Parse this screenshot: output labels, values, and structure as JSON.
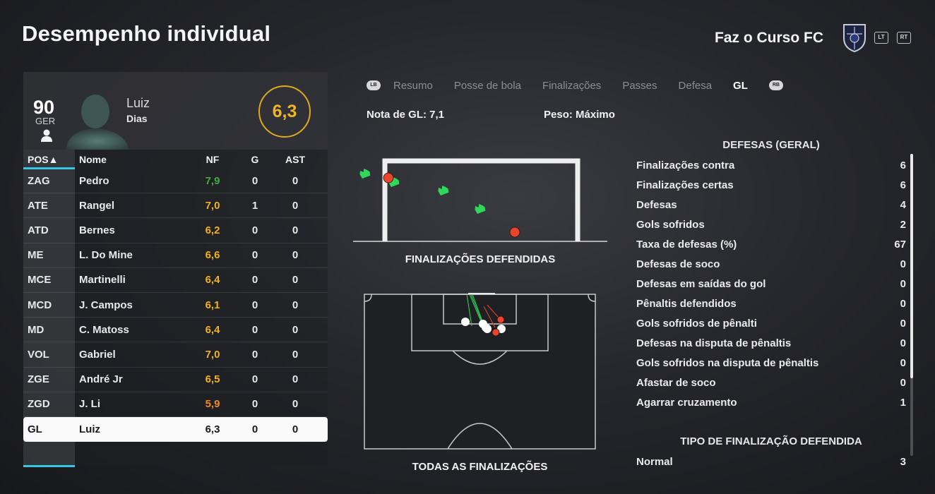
{
  "header": {
    "title": "Desempenho individual",
    "club_name": "Faz o Curso FC",
    "lt_label": "LT",
    "rt_label": "RT"
  },
  "player": {
    "overall": "90",
    "position": "GER",
    "first_name": "Luiz",
    "last_name": "Dias",
    "match_rating": "6,3"
  },
  "table": {
    "headers": {
      "pos": "POS▲",
      "name": "Nome",
      "nf": "NF",
      "g": "G",
      "ast": "AST"
    },
    "rows": [
      {
        "pos": "ZAG",
        "name": "Pedro",
        "nf": "7,9",
        "g": "0",
        "ast": "0",
        "nf_color": "#3fae3f"
      },
      {
        "pos": "ATE",
        "name": "Rangel",
        "nf": "7,0",
        "g": "1",
        "ast": "0",
        "nf_color": "#f0b21f"
      },
      {
        "pos": "ATD",
        "name": "Bernes",
        "nf": "6,2",
        "g": "0",
        "ast": "0",
        "nf_color": "#f0b21f"
      },
      {
        "pos": "ME",
        "name": "L. Do Mine",
        "nf": "6,6",
        "g": "0",
        "ast": "0",
        "nf_color": "#f0b21f"
      },
      {
        "pos": "MCE",
        "name": "Martinelli",
        "nf": "6,4",
        "g": "0",
        "ast": "0",
        "nf_color": "#f0b21f"
      },
      {
        "pos": "MCD",
        "name": "J. Campos",
        "nf": "6,1",
        "g": "0",
        "ast": "0",
        "nf_color": "#f0b21f"
      },
      {
        "pos": "MD",
        "name": "C. Matoss",
        "nf": "6,4",
        "g": "0",
        "ast": "0",
        "nf_color": "#f0b21f"
      },
      {
        "pos": "VOL",
        "name": "Gabriel",
        "nf": "7,0",
        "g": "0",
        "ast": "0",
        "nf_color": "#f0b21f"
      },
      {
        "pos": "ZGE",
        "name": "André Jr",
        "nf": "6,5",
        "g": "0",
        "ast": "0",
        "nf_color": "#f0b21f"
      },
      {
        "pos": "ZGD",
        "name": "J. Li",
        "nf": "5,9",
        "g": "0",
        "ast": "0",
        "nf_color": "#f08a24"
      },
      {
        "pos": "GL",
        "name": "Luiz",
        "nf": "6,3",
        "g": "0",
        "ast": "0",
        "nf_color": "#1a1a1e"
      }
    ]
  },
  "tabs": {
    "lb_label": "LB",
    "rb_label": "RB",
    "items": [
      "Resumo",
      "Posse de bola",
      "Finalizações",
      "Passes",
      "Defesa",
      "GL"
    ],
    "active_index": 5
  },
  "gk": {
    "rating_label": "Nota de GL: 7,1",
    "weight_label": "Peso: Máximo"
  },
  "goal_chart": {
    "caption": "FINALIZAÇÕES DEFENDIDAS"
  },
  "pitch_chart": {
    "caption": "TODAS AS FINALIZAÇÕES"
  },
  "stats": {
    "title": "DEFESAS (GERAL)",
    "rows": [
      {
        "label": "Finalizações contra",
        "value": "6"
      },
      {
        "label": "Finalizações certas",
        "value": "6"
      },
      {
        "label": "Defesas",
        "value": "4"
      },
      {
        "label": "Gols sofridos",
        "value": "2"
      },
      {
        "label": "Taxa de defesas (%)",
        "value": "67"
      },
      {
        "label": "Defesas de soco",
        "value": "0"
      },
      {
        "label": "Defesas em saídas do gol",
        "value": "0"
      },
      {
        "label": "Pênaltis defendidos",
        "value": "0"
      },
      {
        "label": "Gols sofridos de pênalti",
        "value": "0"
      },
      {
        "label": "Defesas na disputa de pênaltis",
        "value": "0"
      },
      {
        "label": "Gols sofridos na disputa de pênaltis",
        "value": "0"
      },
      {
        "label": "Afastar de soco",
        "value": "0"
      },
      {
        "label": "Agarrar cruzamento",
        "value": "1"
      }
    ],
    "type_title": "TIPO DE FINALIZAÇÃO DEFENDIDA",
    "type_rows": [
      {
        "label": "Normal",
        "value": "3"
      }
    ]
  },
  "colors": {
    "accent_cyan": "#35c7e6",
    "rating_gold": "#f1b422",
    "save_green": "#2fd85a",
    "goal_red": "#e8452a"
  }
}
